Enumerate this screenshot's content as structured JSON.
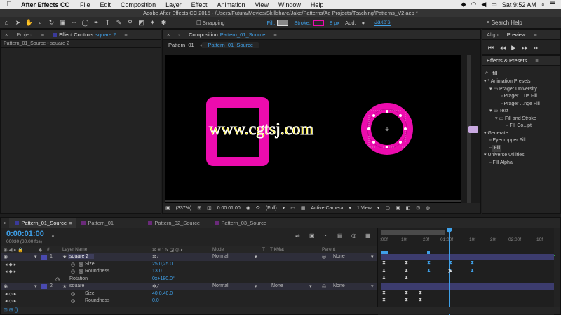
{
  "menubar": {
    "app": "After Effects CC",
    "items": [
      "File",
      "Edit",
      "Composition",
      "Layer",
      "Effect",
      "Animation",
      "View",
      "Window",
      "Help"
    ],
    "clock": "Sat 9:52 AM"
  },
  "app_title": "Adobe After Effects CC 2015 - /Users/Futura/Movies/Skillshare/Jake/Patterns/Ae Projects/Teaching/Patterns_V2.aep *",
  "toolbar": {
    "snapping": "Snapping",
    "fill_label": "Fill:",
    "stroke_label": "Stroke:",
    "stroke_width": "8 px",
    "add_label": "Add:",
    "workspace": "Jake's",
    "search_help": "Search Help"
  },
  "project_panel": {
    "tab_project": "Project",
    "tab_effect_controls": "Effect Controls",
    "effect_controls_target": "square 2",
    "breadcrumb": "Pattern_01_Source • square 2"
  },
  "comp_panel": {
    "tab_label": "Composition",
    "tab_name": "Pattern_01_Source",
    "nav": [
      "Pattern_01",
      "Pattern_01_Source"
    ],
    "zoom": "(337%)",
    "time": "0:00:01:00",
    "resolution": "(Full)",
    "camera": "Active Camera",
    "view": "1 View",
    "watermark": "www.cgtsj.com"
  },
  "align_panel": {
    "tab_align": "Align",
    "tab_preview": "Preview"
  },
  "effects_panel": {
    "title": "Effects & Presets",
    "search": "fill",
    "tree": [
      "* Animation Presets",
      "Prager University",
      "Prager ...ue Fill",
      "Prager ...nge Fill",
      "Text",
      "Fill and Stroke",
      "Fill Co...pt",
      "Generate",
      "Eyedropper Fill",
      "Fill",
      "Universe Utilities",
      "Fill Alpha"
    ]
  },
  "timeline": {
    "tabs": [
      "Pattern_01_Source",
      "Pattern_01",
      "Pattern_02_Source",
      "Pattern_03_Source"
    ],
    "timecode": "0:00:01:00",
    "fps": "00030 (30.00 fps)",
    "headers": {
      "num": "#",
      "layer_name": "Layer Name",
      "mode": "Mode",
      "t": "T",
      "trkmat": "TrkMat",
      "parent": "Parent"
    },
    "rows": [
      {
        "num": "1",
        "name": "square 2",
        "mode": "Normal",
        "parent": "None"
      },
      {
        "prop": "Size",
        "value": "25.0,25.0"
      },
      {
        "prop": "Roundness",
        "value": "13.0"
      },
      {
        "prop": "Rotation",
        "value": "0x+180.0°"
      },
      {
        "num": "2",
        "name": "square",
        "mode": "Normal",
        "trkmat": "None",
        "parent": "None"
      },
      {
        "prop": "Size",
        "value": "40.0,40.0"
      },
      {
        "prop": "Roundness",
        "value": "0.0"
      }
    ],
    "ruler": [
      ":00f",
      "10f",
      "20f",
      "01:00f",
      "10f",
      "20f",
      "02:00f",
      "10f"
    ]
  },
  "colors": {
    "accent": "#3fa0e8",
    "magenta": "#ec0cae",
    "panel": "#232323"
  }
}
